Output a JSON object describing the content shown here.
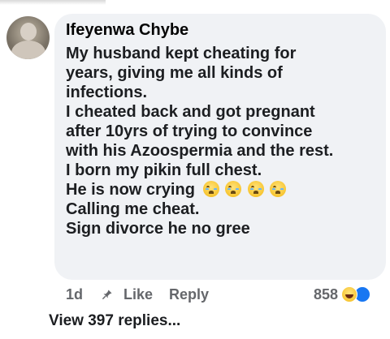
{
  "comment": {
    "author": "Ifeyenwa Chybe",
    "lines": [
      "My husband kept cheating for",
      "years, giving me all kinds of",
      "infections.",
      "I cheated back and got pregnant",
      "after 10yrs of trying to convince",
      "with his Azoospermia and the rest.",
      "I born my pikin full chest.",
      "He is now crying",
      "Calling me cheat.",
      "Sign divorce he no gree"
    ],
    "inline_emoji": [
      "crying-face-icon",
      "crying-face-icon",
      "crying-face-icon",
      "crying-face-icon"
    ]
  },
  "actions": {
    "age": "1d",
    "like_label": "Like",
    "reply_label": "Reply",
    "reaction_count": "858",
    "reaction_icons": [
      "haha-reaction-icon",
      "like-reaction-icon"
    ]
  },
  "replies": {
    "view_label": "View 397 replies..."
  },
  "colors": {
    "bubble": "#f0f2f5",
    "text": "#1c1e21",
    "meta": "#65676b",
    "like_reaction": "#1877f2"
  }
}
